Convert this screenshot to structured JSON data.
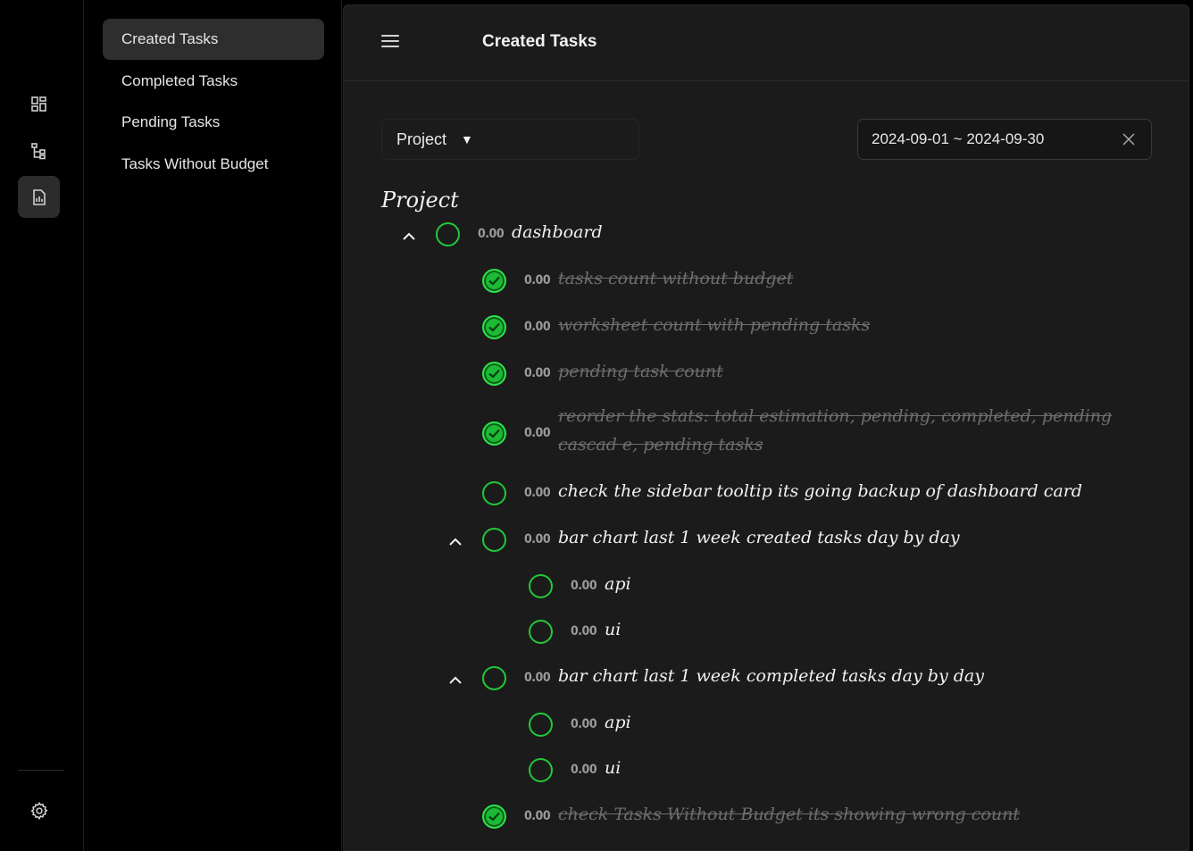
{
  "rail": {
    "icons": [
      "dashboard-icon",
      "hierarchy-icon",
      "report-icon"
    ],
    "bottom_icon": "gear-icon"
  },
  "subnav": {
    "items": [
      {
        "label": "Created Tasks",
        "active": true
      },
      {
        "label": "Completed Tasks",
        "active": false
      },
      {
        "label": "Pending Tasks",
        "active": false
      },
      {
        "label": "Tasks Without Budget",
        "active": false
      }
    ]
  },
  "header": {
    "title": "Created Tasks"
  },
  "filters": {
    "group_by": "Project",
    "date_range": "2024-09-01 ~ 2024-09-30"
  },
  "section": {
    "title": "Project"
  },
  "colors": {
    "accent_green": "#21c93a",
    "background": "#1b1b1b"
  },
  "tree": {
    "root": {
      "value": "0.00",
      "label": "dashboard"
    },
    "tasks": [
      {
        "value": "0.00",
        "label": "tasks count without budget",
        "done": true
      },
      {
        "value": "0.00",
        "label": "worksheet count with pending tasks",
        "done": true
      },
      {
        "value": "0.00",
        "label": "pending task count",
        "done": true
      },
      {
        "value": "0.00",
        "label": "reorder the stats: total estimation, pending, completed, pending cascad e, pending tasks",
        "done": true
      },
      {
        "value": "0.00",
        "label": "check the sidebar tooltip its going backup of dashboard card",
        "done": false
      },
      {
        "value": "0.00",
        "label": "bar chart last 1 week created tasks day by day",
        "done": false
      },
      {
        "value": "0.00",
        "label": "api",
        "done": false
      },
      {
        "value": "0.00",
        "label": "ui",
        "done": false
      },
      {
        "value": "0.00",
        "label": "bar chart last 1 week completed tasks day by day",
        "done": false
      },
      {
        "value": "0.00",
        "label": "api",
        "done": false
      },
      {
        "value": "0.00",
        "label": "ui",
        "done": false
      },
      {
        "value": "0.00",
        "label": "check Tasks Without Budget its showing wrong count",
        "done": true
      }
    ]
  }
}
